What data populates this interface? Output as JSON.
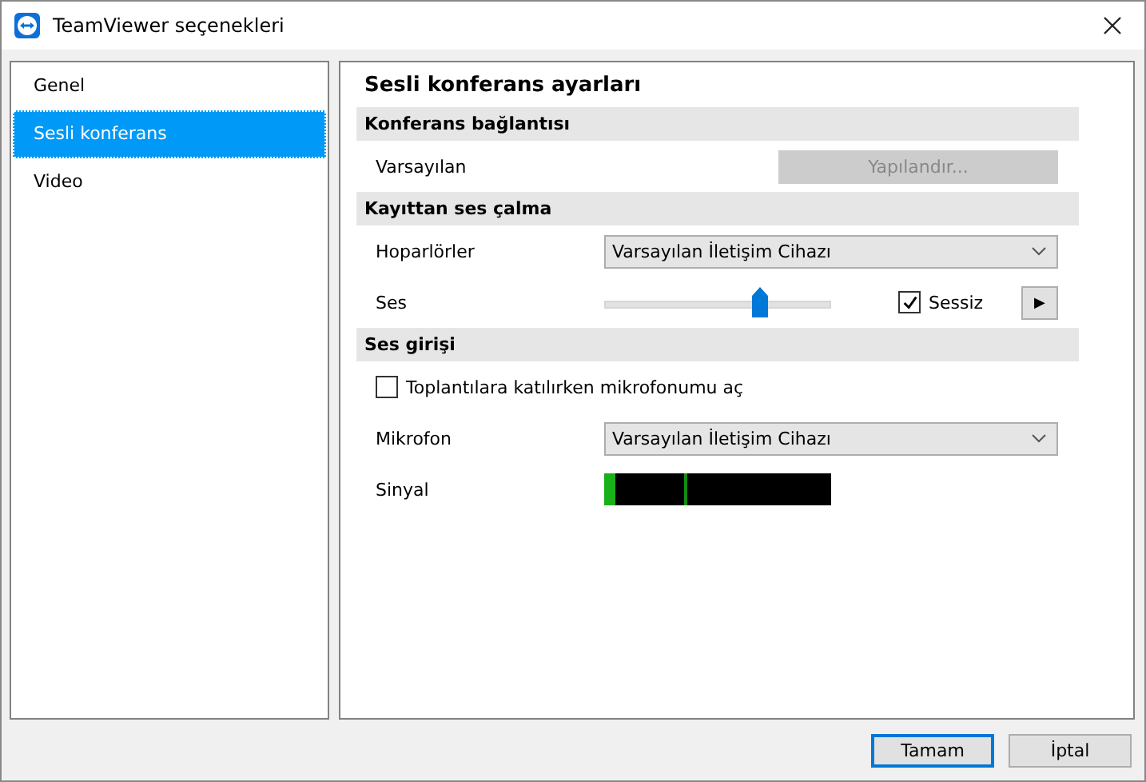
{
  "window": {
    "title": "TeamViewer seçenekleri"
  },
  "sidebar": {
    "items": [
      {
        "label": "Genel",
        "selected": false
      },
      {
        "label": "Sesli konferans",
        "selected": true
      },
      {
        "label": "Video",
        "selected": false
      }
    ]
  },
  "panel": {
    "title": "Sesli konferans ayarları",
    "sections": [
      {
        "title": "Konferans bağlantısı",
        "rows": [
          {
            "kind": "button",
            "label": "Varsayılan",
            "button": "Yapılandır...",
            "disabled": true
          }
        ]
      },
      {
        "title": "Kayıttan ses çalma",
        "rows": [
          {
            "kind": "dropdown",
            "label": "Hoparlörler",
            "value": "Varsayılan İletişim Cihazı"
          },
          {
            "kind": "slider",
            "label": "Ses",
            "level": 0.68,
            "mute": {
              "label": "Sessiz",
              "checked": true
            },
            "play": "▶"
          }
        ]
      },
      {
        "title": "Ses girişi",
        "rows": [
          {
            "kind": "checkbox",
            "label": "Toplantılara katılırken mikrofonumu aç",
            "checked": false
          },
          {
            "kind": "dropdown",
            "label": "Mikrofon",
            "value": "Varsayılan İletişim Cihazı"
          },
          {
            "kind": "meter",
            "label": "Sinyal",
            "level": 0.05,
            "peak": {
              "level": 0.35
            }
          }
        ]
      }
    ]
  },
  "buttons": [
    {
      "label": "Tamam",
      "default": true
    },
    {
      "label": "İptal",
      "default": false
    }
  ]
}
